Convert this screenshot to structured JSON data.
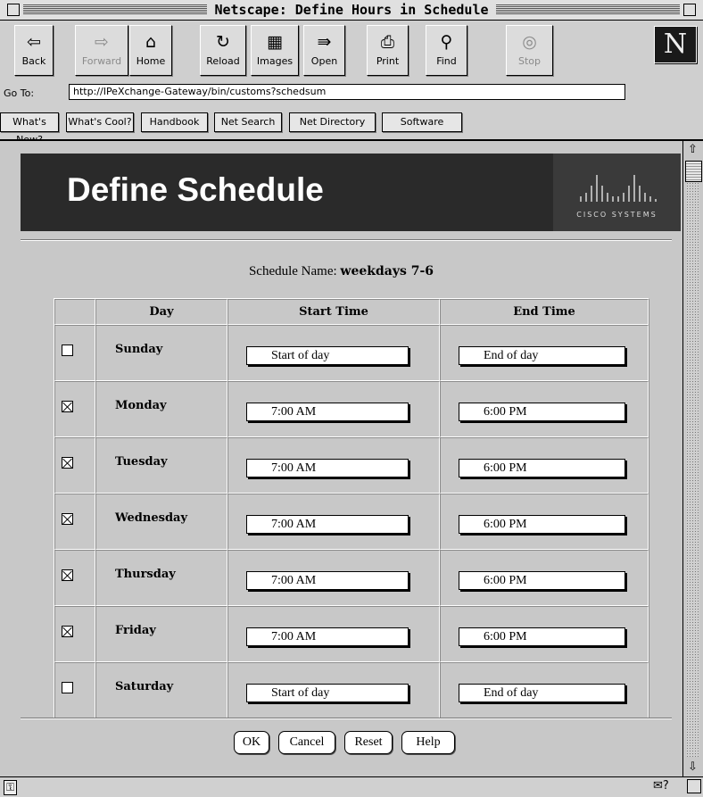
{
  "window": {
    "title": "Netscape: Define Hours in Schedule"
  },
  "toolbar": {
    "buttons": [
      {
        "label": "Back",
        "icon": "back-arrow-icon",
        "glyph": "⇦"
      },
      {
        "label": "Forward",
        "icon": "forward-arrow-icon",
        "glyph": "⇨"
      },
      {
        "label": "Home",
        "icon": "home-icon",
        "glyph": "⌂"
      },
      {
        "label": "Reload",
        "icon": "reload-icon",
        "glyph": "↻"
      },
      {
        "label": "Images",
        "icon": "images-icon",
        "glyph": "▦"
      },
      {
        "label": "Open",
        "icon": "open-icon",
        "glyph": "⇛"
      },
      {
        "label": "Print",
        "icon": "print-icon",
        "glyph": "⎙"
      },
      {
        "label": "Find",
        "icon": "find-icon",
        "glyph": "⚲"
      },
      {
        "label": "Stop",
        "icon": "stop-icon",
        "glyph": "◎"
      }
    ],
    "logo": "N"
  },
  "location": {
    "label": "Go To:",
    "url": "http://IPeXchange-Gateway/bin/customs?schedsum"
  },
  "directory": {
    "buttons": [
      "What's New?",
      "What's Cool?",
      "Handbook",
      "Net Search",
      "Net Directory",
      "Software"
    ]
  },
  "banner": {
    "title": "Define Schedule",
    "logo_text": "CISCO SYSTEMS"
  },
  "schedule": {
    "name_label": "Schedule Name:",
    "name_value": "weekdays 7-6"
  },
  "table": {
    "headers": [
      "Day",
      "Start Time",
      "End Time"
    ],
    "rows": [
      {
        "checked": false,
        "day": "Sunday",
        "start": "Start of day",
        "end": "End of day"
      },
      {
        "checked": true,
        "day": "Monday",
        "start": "7:00 AM",
        "end": "6:00 PM"
      },
      {
        "checked": true,
        "day": "Tuesday",
        "start": "7:00 AM",
        "end": "6:00 PM"
      },
      {
        "checked": true,
        "day": "Wednesday",
        "start": "7:00 AM",
        "end": "6:00 PM"
      },
      {
        "checked": true,
        "day": "Thursday",
        "start": "7:00 AM",
        "end": "6:00 PM"
      },
      {
        "checked": true,
        "day": "Friday",
        "start": "7:00 AM",
        "end": "6:00 PM"
      },
      {
        "checked": false,
        "day": "Saturday",
        "start": "Start of day",
        "end": "End of day"
      }
    ]
  },
  "form_buttons": {
    "ok": "OK",
    "cancel": "Cancel",
    "reset": "Reset",
    "help": "Help"
  }
}
